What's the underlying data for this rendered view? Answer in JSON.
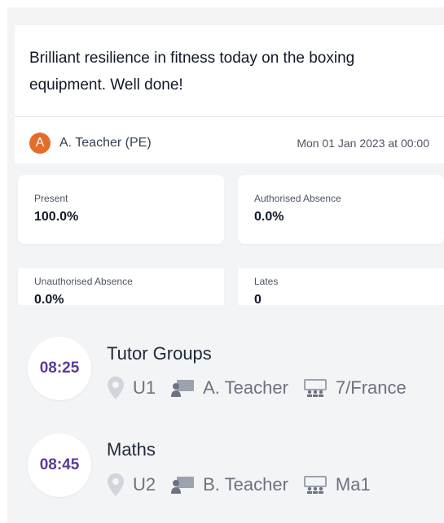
{
  "comment": {
    "text": "Brilliant resilience in fitness today on the boxing equipment. Well done!",
    "avatar_letter": "A",
    "author": "A. Teacher (PE)",
    "date": "Mon 01 Jan 2023 at 00:00"
  },
  "stats": [
    {
      "label": "Present",
      "value": "100.0%"
    },
    {
      "label": "Authorised Absence",
      "value": "0.0%"
    },
    {
      "label": "Unauthorised Absence",
      "value": "0.0%"
    },
    {
      "label": "Lates",
      "value": "0"
    }
  ],
  "lessons": [
    {
      "time": "08:25",
      "title": "Tutor Groups",
      "room": "U1",
      "teacher": "A. Teacher",
      "group": "7/France"
    },
    {
      "time": "08:45",
      "title": "Maths",
      "room": "U2",
      "teacher": "B. Teacher",
      "group": "Ma1"
    }
  ],
  "icons": {
    "room": "location-pin-icon",
    "teacher": "teacher-board-icon",
    "group": "class-group-icon"
  },
  "colors": {
    "avatar": "#e46d2a",
    "time_text": "#5b3a9b",
    "background": "#f3f4f6"
  }
}
